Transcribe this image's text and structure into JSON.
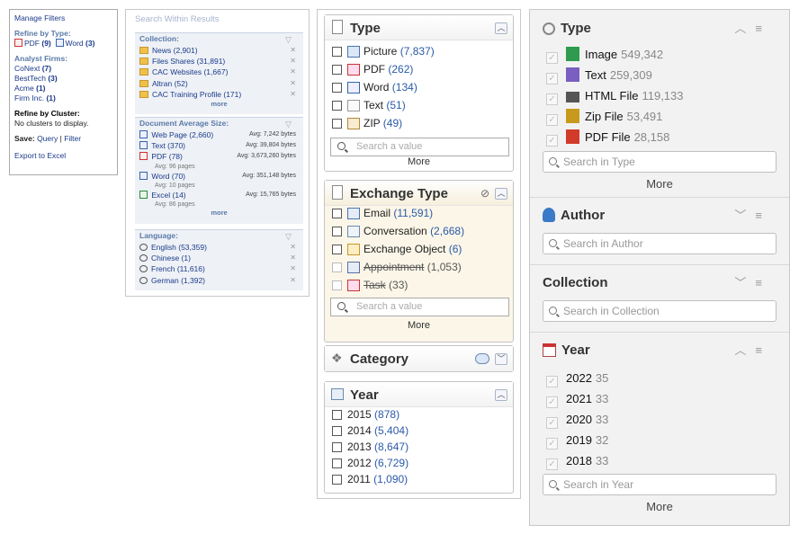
{
  "panel1": {
    "manage": "Manage Filters",
    "refine_type": "Refine by Type:",
    "pdf": "PDF",
    "pdf_count": "(9)",
    "word": "Word",
    "word_count": "(3)",
    "analyst": "Analyst Firms:",
    "firms": [
      {
        "name": "CoNext",
        "count": "(7)"
      },
      {
        "name": "BestTech",
        "count": "(3)"
      },
      {
        "name": "Acme",
        "count": "(1)"
      },
      {
        "name": "Firm Inc.",
        "count": "(1)"
      }
    ],
    "cluster_h": "Refine by Cluster:",
    "cluster_msg": "No clusters to display.",
    "save": "Save:",
    "query": "Query",
    "sep": "|",
    "filter": "Filter",
    "export": "Export to Excel"
  },
  "panel2": {
    "search_placeholder": "Search Within Results",
    "collection_h": "Collection:",
    "collection": [
      "News (2,901)",
      "Files Shares (31,891)",
      "CAC Websites (1,667)",
      "Altran (52)",
      "CAC Training Profile (171)"
    ],
    "more": "more",
    "docsize_h": "Document Average Size:",
    "docsize": [
      {
        "label": "Web Page (2,660)",
        "avg": "Avg: 7,242 bytes",
        "sub": ""
      },
      {
        "label": "Text (370)",
        "avg": "Avg: 39,804 bytes",
        "sub": ""
      },
      {
        "label": "PDF (78)",
        "avg": "Avg: 3,673,260 bytes",
        "sub": "Avg: 96 pages"
      },
      {
        "label": "Word (70)",
        "avg": "Avg: 351,148 bytes",
        "sub": "Avg: 10 pages"
      },
      {
        "label": "Excel (14)",
        "avg": "Avg: 15,765 bytes",
        "sub": "Avg: 86 pages"
      }
    ],
    "language_h": "Language:",
    "language": [
      "English (53,359)",
      "Chinese (1)",
      "French (11,616)",
      "German (1,392)"
    ]
  },
  "panel3": {
    "type": {
      "title": "Type",
      "items": [
        {
          "label": "Picture",
          "count": "(7,837)",
          "icon": "picture-icon"
        },
        {
          "label": "PDF",
          "count": "(262)",
          "icon": "pdf-icon"
        },
        {
          "label": "Word",
          "count": "(134)",
          "icon": "word-icon"
        },
        {
          "label": "Text",
          "count": "(51)",
          "icon": "text-icon"
        },
        {
          "label": "ZIP",
          "count": "(49)",
          "icon": "zip-icon"
        }
      ],
      "search": "Search a value",
      "more": "More"
    },
    "exchange": {
      "title": "Exchange Type",
      "items": [
        {
          "label": "Email",
          "count": "(11,591)"
        },
        {
          "label": "Conversation",
          "count": "(2,668)"
        },
        {
          "label": "Exchange Object",
          "count": "(6)"
        },
        {
          "label": "Appointment",
          "count": "(1,053)"
        },
        {
          "label": "Task",
          "count": "(33)"
        }
      ],
      "search": "Search a value",
      "more": "More"
    },
    "category": {
      "title": "Category"
    },
    "year": {
      "title": "Year",
      "items": [
        {
          "label": "2015",
          "count": "(878)"
        },
        {
          "label": "2014",
          "count": "(5,404)"
        },
        {
          "label": "2013",
          "count": "(8,647)"
        },
        {
          "label": "2012",
          "count": "(6,729)"
        },
        {
          "label": "2011",
          "count": "(1,090)"
        }
      ]
    }
  },
  "panel4": {
    "type": {
      "title": "Type",
      "items": [
        {
          "label": "Image",
          "count": "549,342",
          "color": "#2e9b4e"
        },
        {
          "label": "Text",
          "count": "259,309",
          "color": "#7a5ec2"
        },
        {
          "label": "HTML File",
          "count": "119,133",
          "color": "#555555"
        },
        {
          "label": "Zip File",
          "count": "53,491",
          "color": "#c79a1e"
        },
        {
          "label": "PDF File",
          "count": "28,158",
          "color": "#d23a2a"
        }
      ],
      "search": "Search in Type",
      "more": "More"
    },
    "author": {
      "title": "Author",
      "search": "Search in Author"
    },
    "collection": {
      "title": "Collection",
      "search": "Search in Collection"
    },
    "year": {
      "title": "Year",
      "items": [
        {
          "label": "2022",
          "count": "35"
        },
        {
          "label": "2021",
          "count": "33"
        },
        {
          "label": "2020",
          "count": "33"
        },
        {
          "label": "2019",
          "count": "32"
        },
        {
          "label": "2018",
          "count": "33"
        }
      ],
      "search": "Search in Year",
      "more": "More"
    }
  }
}
